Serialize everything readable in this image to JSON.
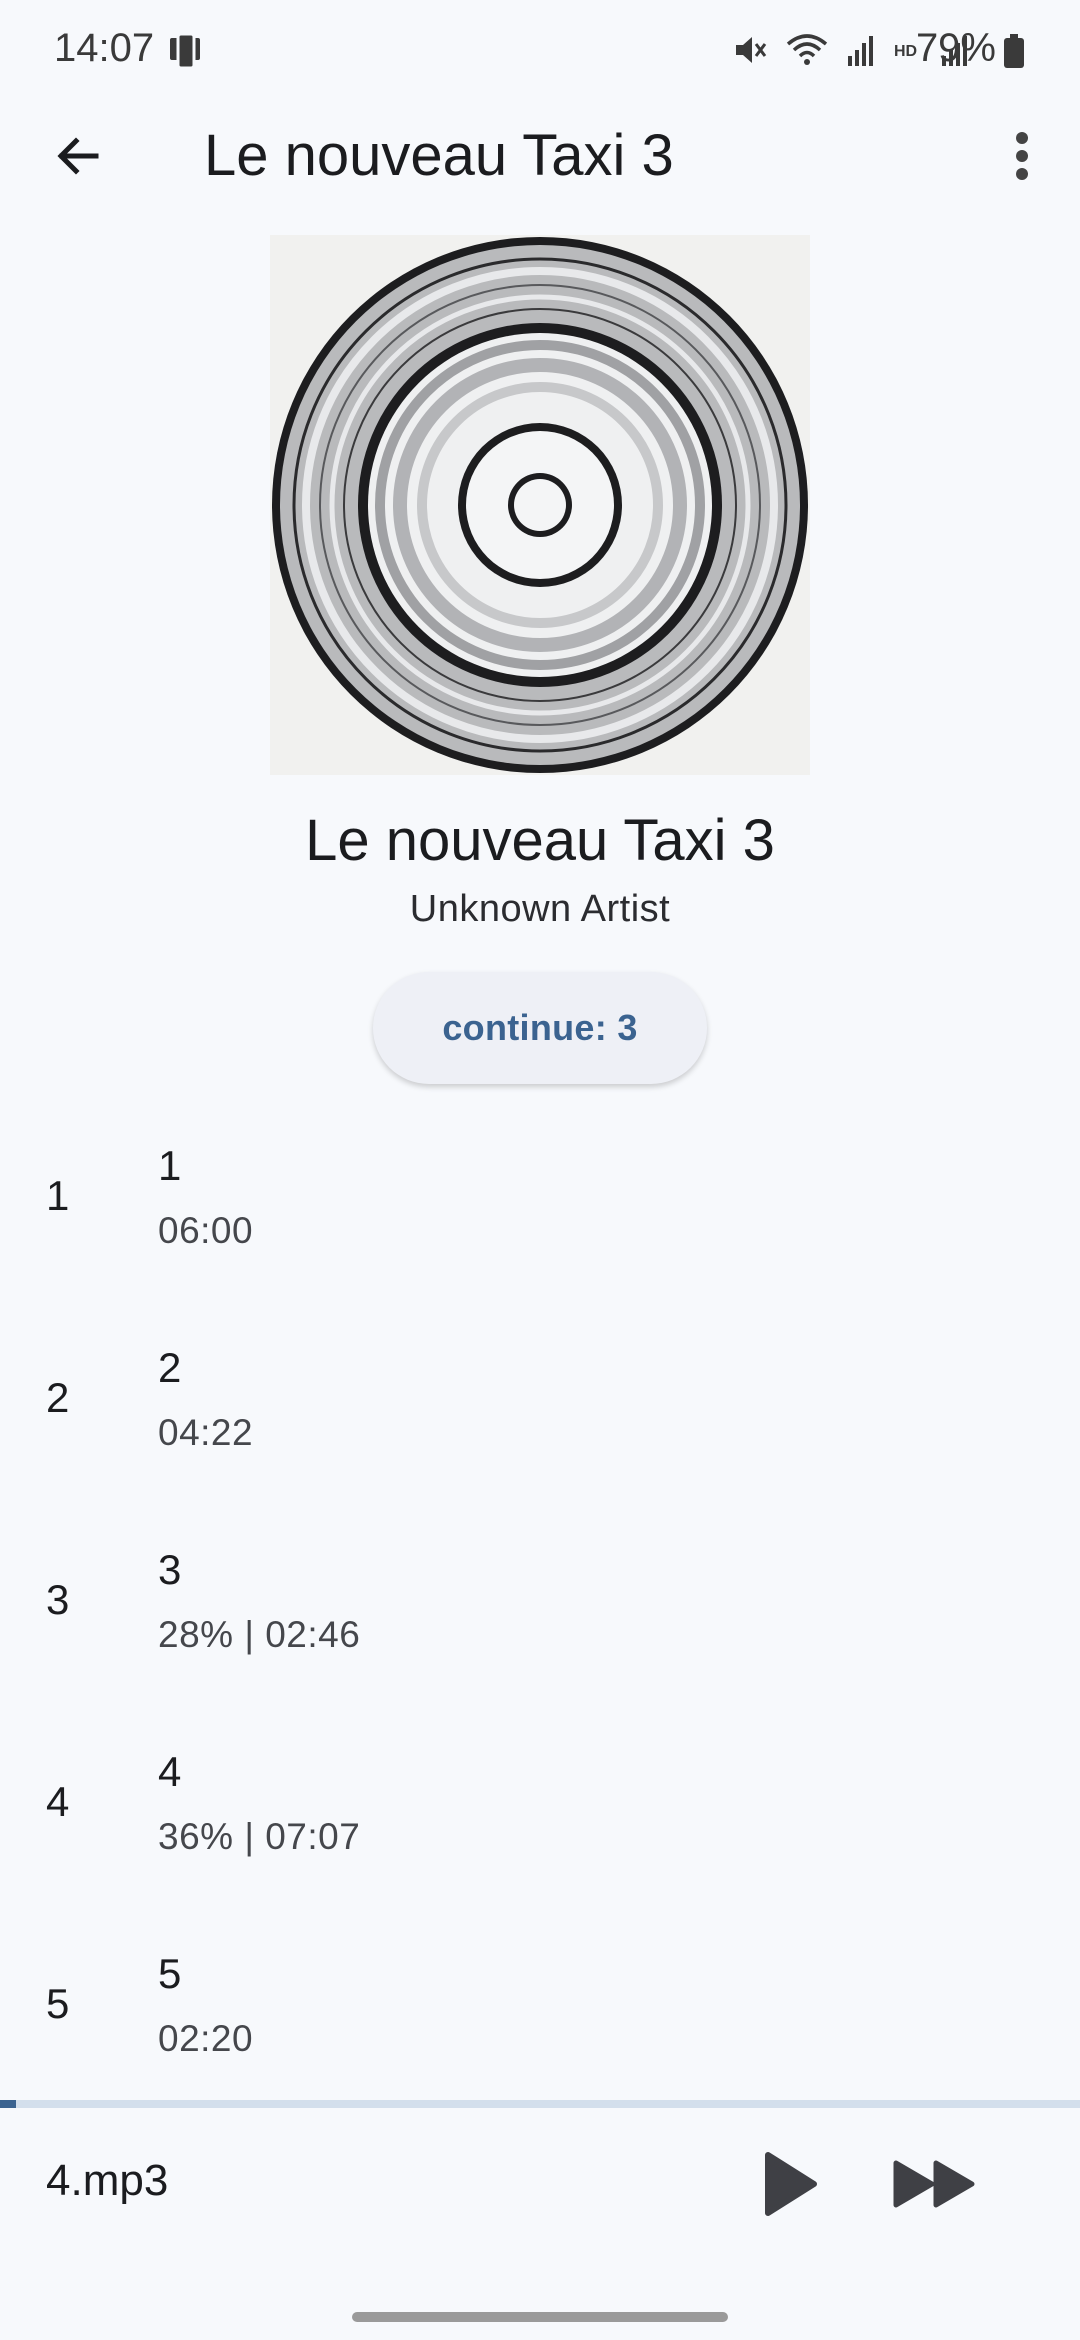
{
  "status_bar": {
    "time": "14:07",
    "battery": "79%",
    "icons": [
      "phone-cast-icon",
      "mute-icon",
      "wifi-icon",
      "signal-icon",
      "hd-icon",
      "signal-roaming-icon",
      "battery-icon"
    ]
  },
  "app_bar": {
    "title": "Le nouveau Taxi 3",
    "back_icon": "arrow-back-icon",
    "menu_icon": "more-vert-icon"
  },
  "album": {
    "title": "Le nouveau Taxi 3",
    "artist": "Unknown Artist",
    "cover_icon": "vinyl-record-cover"
  },
  "continue_button": {
    "label": "continue: 3"
  },
  "tracks": [
    {
      "number": "1",
      "title": "1",
      "subtitle": "06:00"
    },
    {
      "number": "2",
      "title": "2",
      "subtitle": "04:22"
    },
    {
      "number": "3",
      "title": "3",
      "subtitle": "28% | 02:46"
    },
    {
      "number": "4",
      "title": "4",
      "subtitle": "36% | 07:07"
    },
    {
      "number": "5",
      "title": "5",
      "subtitle": "02:20"
    }
  ],
  "player": {
    "title": "4.mp3",
    "progress": 0.015,
    "accent_color": "#3b6390",
    "track_color": "#d3dfec"
  }
}
